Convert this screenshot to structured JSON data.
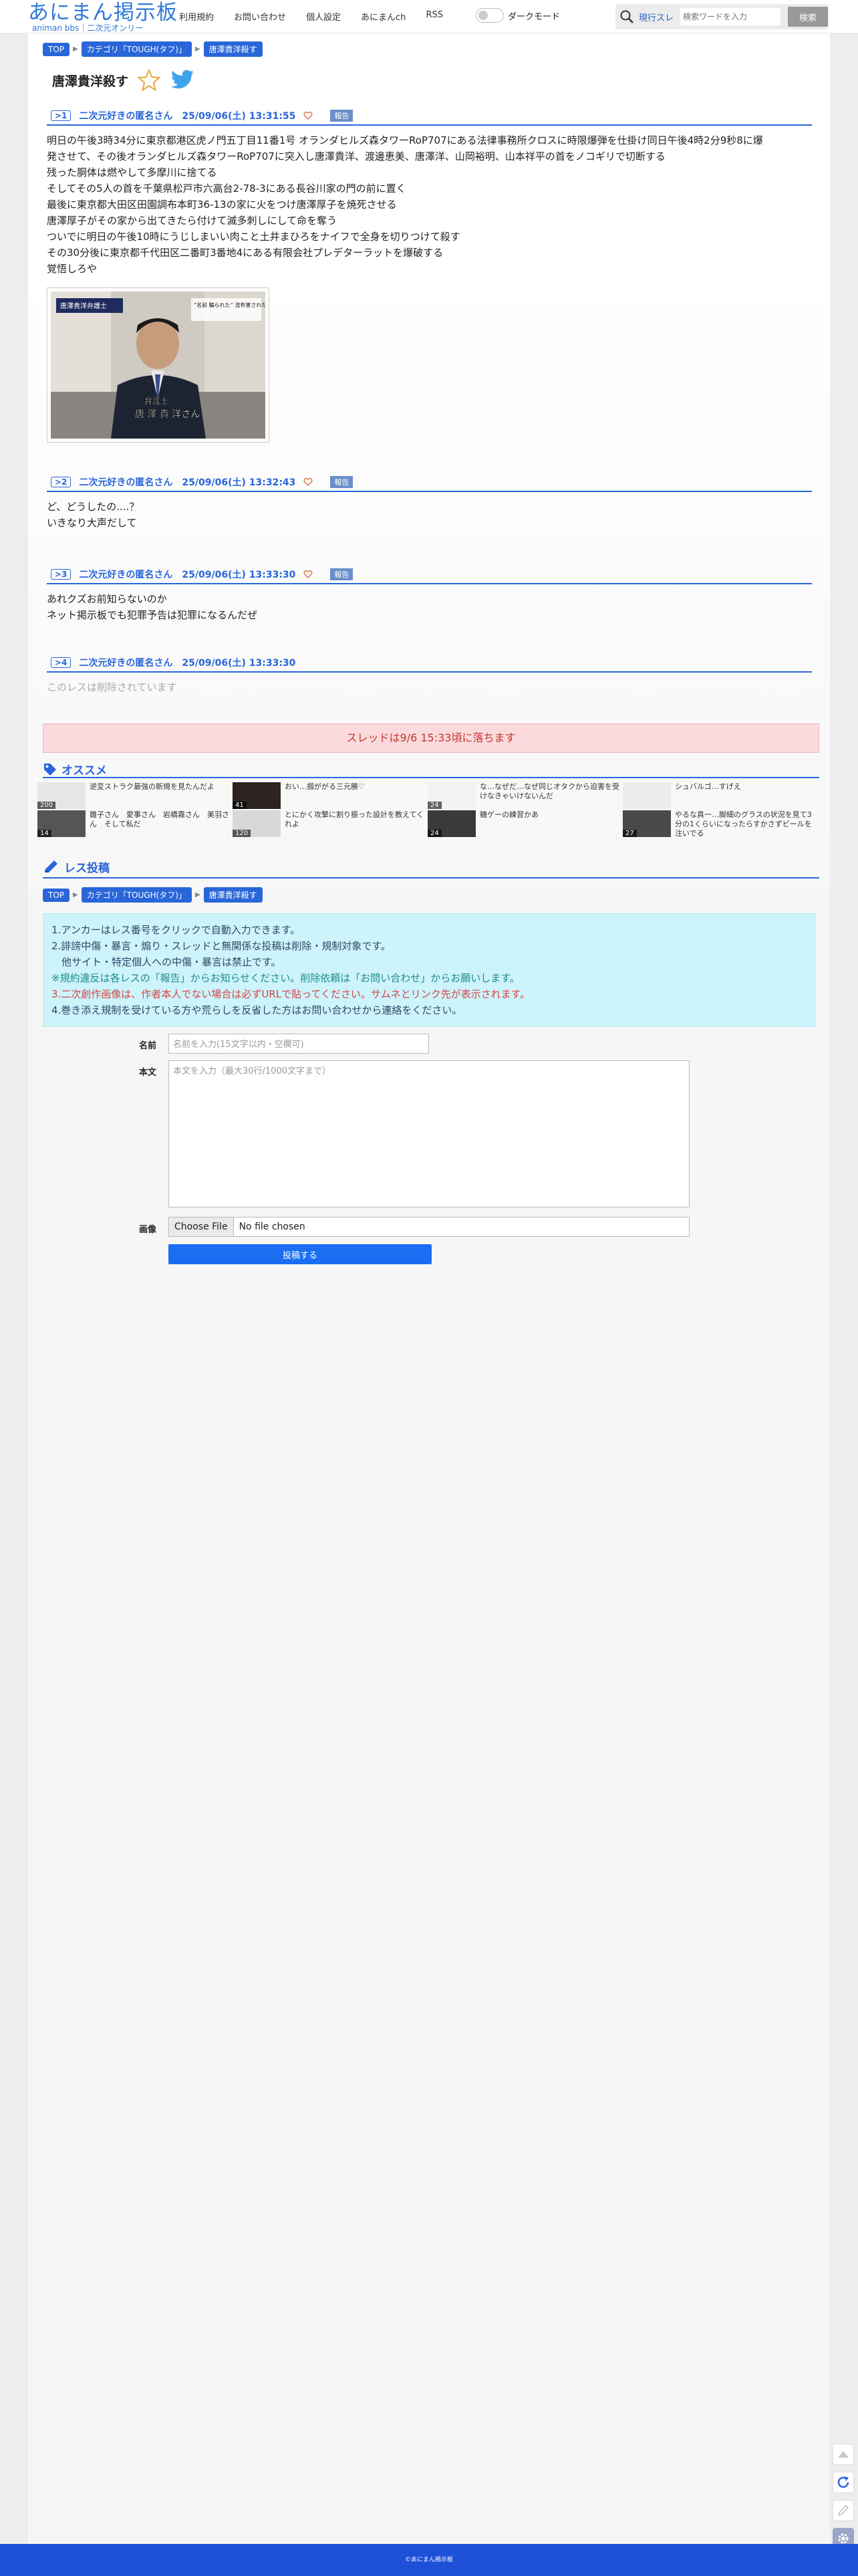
{
  "header": {
    "logo_main": "あにまん掲示板",
    "logo_sub": "animan bbs｜二次元オンリー",
    "nav": [
      "利用規約",
      "お問い合わせ",
      "個人設定",
      "あにまんch",
      "RSS"
    ],
    "dark_mode_label": "ダークモード",
    "search_scope": "現行スレ",
    "search_placeholder": "検索ワードを入力",
    "search_button": "検索"
  },
  "breadcrumb": [
    "TOP",
    "カテゴリ「TOUGH(タフ)」",
    "唐澤貴洋殺す"
  ],
  "thread_title": "唐澤貴洋殺す",
  "posts": [
    {
      "num": ">1",
      "name": "二次元好きの匿名さん",
      "date": "25/09/06(土) 13:31:55",
      "report": "報告",
      "lines": [
        "明日の午後3時34分に東京都港区虎ノ門五丁目11番1号 オランダヒルズ森タワーRoP707にある法律事務所クロスに時限爆弾を仕掛け同日午後4時2分9秒8に爆",
        "発させて、その後オランダヒルズ森タワーRoP707に突入し唐澤貴洋、渡邊恵美、唐澤洋、山岡裕明、山本祥平の首をノコギリで切断する",
        "残った胴体は燃やして多摩川に捨てる",
        "そしてその5人の首を千葉県松戸市六高台2-78-3にある長谷川家の門の前に置く",
        "最後に東京都大田区田園調布本町36-13の家に火をつけ唐澤厚子を焼死させる",
        "唐澤厚子がその家から出てきたら付けて滅多刺しにして命を奪う",
        "ついでに明日の午後10時にうじしまいい肉こと土井まひろをナイフで全身を切りつけて殺す",
        "その30分後に東京都千代田区二番町3番地4にある有限会社プレデターラットを爆破する",
        "覚悟しろや"
      ],
      "image": {
        "caption_tl": "唐澤貴洋弁護士",
        "caption_tr": "“名前 騙られた” 流布害された弁護士は",
        "role": "弁護士",
        "name": "唐 澤 貴 洋さん"
      }
    },
    {
      "num": ">2",
      "name": "二次元好きの匿名さん",
      "date": "25/09/06(土) 13:32:43",
      "report": "報告",
      "lines": [
        "ど、どうしたの....？",
        "いきなり大声だして"
      ]
    },
    {
      "num": ">3",
      "name": "二次元好きの匿名さん",
      "date": "25/09/06(土) 13:33:30",
      "report": "報告",
      "lines": [
        "あれクズお前知らないのか",
        "ネット掲示板でも犯罪予告は犯罪になるんだぜ"
      ]
    },
    {
      "num": ">4",
      "name": "二次元好きの匿名さん",
      "date": "25/09/06(土) 13:33:30",
      "report": "",
      "lines": [
        "このレスは削除されています"
      ]
    }
  ],
  "drop_notice": "スレッドは9/6 15:33頃に落ちます",
  "recommend": {
    "title": "オススメ",
    "items": [
      {
        "count": "200",
        "text": "逆変ストラク最強の新規を見たんだよ"
      },
      {
        "count": "41",
        "text": "おい…掴ががる三元勝♡"
      },
      {
        "count": "24",
        "text": "な…なぜだ…なぜ同じオタクから迫害を受けなきゃいけないんだ"
      },
      {
        "count": "",
        "text": "シュバルゴ…すげえ"
      },
      {
        "count": "14",
        "text": "雛子さん　愛事さん　岩橋霧さん　美羽さん　そして私だ"
      },
      {
        "count": "120",
        "text": "とにかく攻撃に割り振った設計を教えてくれよ"
      },
      {
        "count": "24",
        "text": "糖ゲーの練習かあ"
      },
      {
        "count": "27",
        "text": "やるな真一…脚細のグラスの状況を見て3分の1くらいになったらすかさずビールを注いでる"
      }
    ]
  },
  "post_section": {
    "title": "レス投稿",
    "notice_lines": [
      "1.アンカーはレス番号をクリックで自動入力できます。",
      "2.誹謗中傷・暴言・煽り・スレッドと無関係な投稿は削除・規制対象です。",
      "　他サイト・特定個人への中傷・暴言は禁止です。",
      "※規約違反は各レスの「報告」からお知らせください。削除依頼は「お問い合わせ」からお願いします。",
      "3.二次創作画像は、作者本人でない場合は必ずURLで貼ってください。サムネとリンク先が表示されます。",
      "4.巻き添え規制を受けている方や荒らしを反省した方はお問い合わせから連絡をください。"
    ],
    "name_label": "名前",
    "name_placeholder": "名前を入力(15文字以内・空欄可)",
    "body_label": "本文",
    "body_placeholder": "本文を入力（最大30行/1000文字まで）",
    "image_label": "画像",
    "file_button": "Choose File",
    "file_none": "No file chosen",
    "submit": "投稿する"
  },
  "footer": "©あにまん掲示板"
}
